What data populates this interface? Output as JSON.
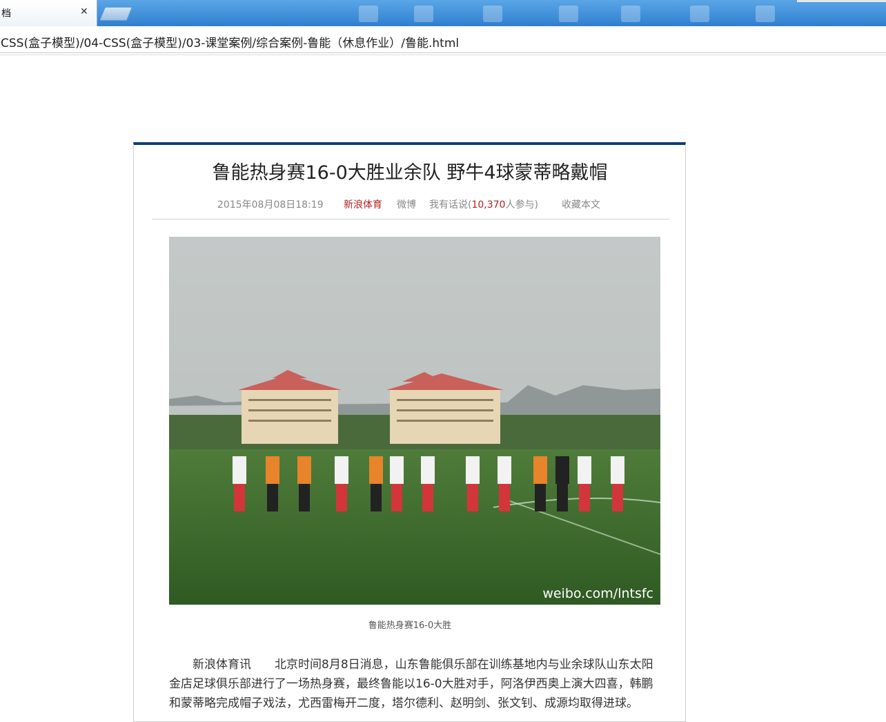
{
  "browser": {
    "tab_title": "档",
    "close_glyph": "✕",
    "address": "CSS(盒子模型)/04-CSS(盒子模型)/03-课堂案例/综合案例-鲁能（休息作业）/鲁能.html"
  },
  "article": {
    "title": "鲁能热身赛16-0大胜业余队 野牛4球蒙蒂略戴帽",
    "date": "2015年08月08日18:19",
    "source": "新浪体育",
    "weibo": "微博",
    "comment_prefix": "我有话说(",
    "comment_count": "10,370",
    "comment_suffix": "人参与)",
    "bookmark": "收藏本文",
    "image_watermark": "weibo.com/lntsfc",
    "caption": "鲁能热身赛16-0大胜",
    "body": "新浪体育讯　　北京时间8月8日消息，山东鲁能俱乐部在训练基地内与业余球队山东太阳金店足球俱乐部进行了一场热身赛，最终鲁能以16-0大胜对手，阿洛伊西奥上演大四喜，韩鹏和蒙蒂略完成帽子戏法，尤西雷梅开二度，塔尔德利、赵明剑、张文钊、成源均取得进球。"
  },
  "colors": {
    "accent_bar": "#0d3d77",
    "source_red": "#b01e1e",
    "meta_gray": "#888888"
  }
}
